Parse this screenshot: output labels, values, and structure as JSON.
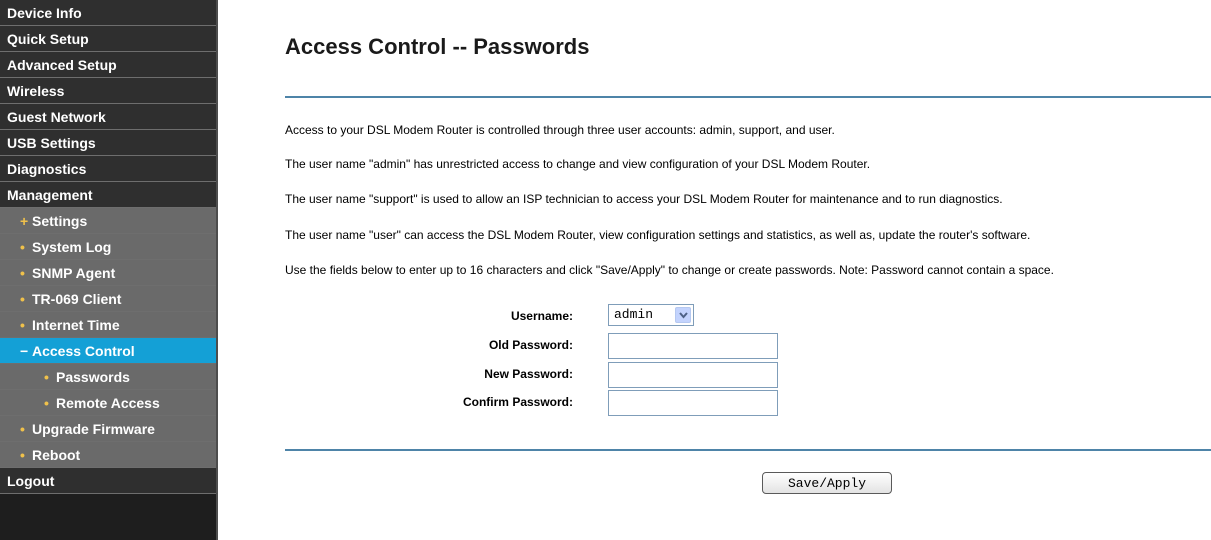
{
  "sidebar": {
    "items": [
      {
        "label": "Device Info"
      },
      {
        "label": "Quick Setup"
      },
      {
        "label": "Advanced Setup"
      },
      {
        "label": "Wireless"
      },
      {
        "label": "Guest Network"
      },
      {
        "label": "USB Settings"
      },
      {
        "label": "Diagnostics"
      },
      {
        "label": "Management"
      },
      {
        "label": "Settings",
        "bullet": "+"
      },
      {
        "label": "System Log",
        "bullet": "•"
      },
      {
        "label": "SNMP Agent",
        "bullet": "•"
      },
      {
        "label": "TR-069 Client",
        "bullet": "•"
      },
      {
        "label": "Internet Time",
        "bullet": "•"
      },
      {
        "label": "Access Control",
        "bullet": "−"
      },
      {
        "label": "Passwords",
        "bullet": "•"
      },
      {
        "label": "Remote Access",
        "bullet": "•"
      },
      {
        "label": "Upgrade Firmware",
        "bullet": "•"
      },
      {
        "label": "Reboot",
        "bullet": "•"
      },
      {
        "label": "Logout"
      }
    ],
    "active_index": 13
  },
  "main": {
    "title": "Access Control -- Passwords",
    "paragraphs": [
      "Access to your DSL Modem Router is controlled through three user accounts: admin, support, and user.",
      "The user name \"admin\" has unrestricted access to change and view configuration of your DSL Modem Router.",
      "The user name \"support\" is used to allow an ISP technician to access your DSL Modem Router for maintenance and to run diagnostics.",
      "The user name \"user\" can access the DSL Modem Router, view configuration settings and statistics, as well as, update the router's software.",
      "Use the fields below to enter up to 16 characters and click \"Save/Apply\" to change or create passwords. Note: Password cannot contain a space."
    ],
    "form": {
      "username_label": "Username:",
      "username_value": "admin",
      "old_password_label": "Old Password:",
      "old_password_value": "",
      "new_password_label": "New Password:",
      "new_password_value": "",
      "confirm_password_label": "Confirm Password:",
      "confirm_password_value": ""
    },
    "save_label": "Save/Apply"
  },
  "colors": {
    "sidebar_bg": "#2f2f2f",
    "submenu_bg": "#6a6a6a",
    "active_bg": "#14a0d6",
    "bullet": "#f0c14b",
    "rule": "#4e84a8"
  }
}
